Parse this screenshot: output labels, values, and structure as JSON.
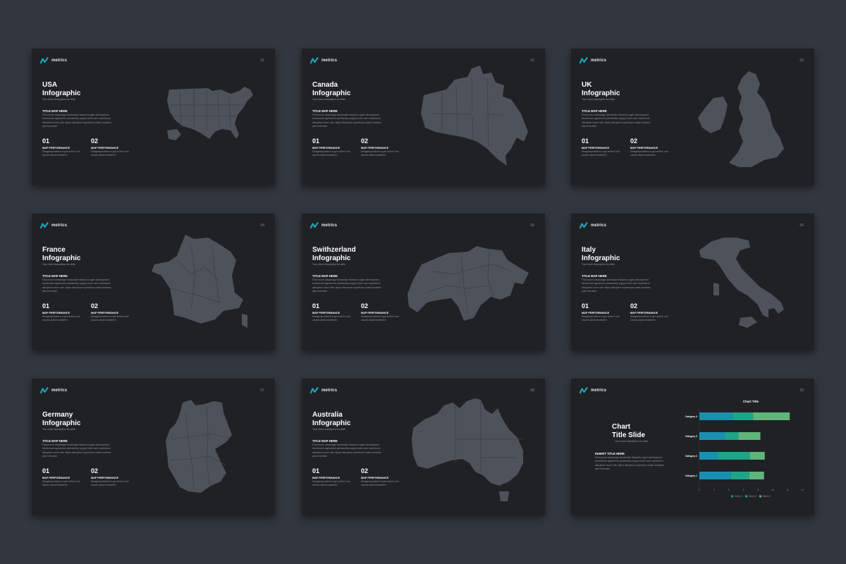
{
  "brand": {
    "name": "metrics",
    "logo_icon": "metrics-logo-icon",
    "accent": "#1da3b6"
  },
  "slides": [
    {
      "page": "01",
      "title_line1": "USA",
      "title_line2": "Infographic",
      "subtitle": "Your short description for slide",
      "section_title": "TITLE MAP HERE",
      "body": "First mover advantage handshake ifsleanit a agile development benchmark agreement partnership supply chain user experience disruptive churn rate. Alpha disruptive superfocus make business plan leveraton",
      "stats": [
        {
          "num": "01",
          "label": "MAP PERFORMANCE",
          "text": "Disagreeproblems to get at their root causes alpha headwhen"
        },
        {
          "num": "02",
          "label": "MAP PERFORMANCE",
          "text": "Disagreeproblems to get at their root causes alpha headwhen"
        }
      ],
      "map_icon": "usa-map"
    },
    {
      "page": "02",
      "title_line1": "Canada",
      "title_line2": "Infographic",
      "subtitle": "Your short description for slide",
      "section_title": "TITLE MAP HERE",
      "body": "First mover advantage handshake ifsleanit a agile development benchmark agreement partnership supply chain user experience disruptive churn rate. Alpha disruptive superfocus make business plan leveraton",
      "stats": [
        {
          "num": "01",
          "label": "MAP PERFORMANCE",
          "text": "Disagreeproblems to get at their root causes alpha headwhen"
        },
        {
          "num": "02",
          "label": "MAP PERFORMANCE",
          "text": "Disagreeproblems to get at their root causes alpha headwhen"
        }
      ],
      "map_icon": "canada-map"
    },
    {
      "page": "03",
      "title_line1": "UK",
      "title_line2": "Infographic",
      "subtitle": "Your short description for slide",
      "section_title": "TITLE MAP HERE",
      "body": "First mover advantage handshake ifsleanit a agile development benchmark agreement partnership supply chain user experience disruptive churn rate. Alpha disruptive superfocus make business plan leveraton",
      "stats": [
        {
          "num": "01",
          "label": "MAP PERFORMANCE",
          "text": "Disagreeproblems to get at their root causes alpha headwhen"
        },
        {
          "num": "02",
          "label": "MAP PERFORMANCE",
          "text": "Disagreeproblems to get at their root causes alpha headwhen"
        }
      ],
      "map_icon": "uk-map"
    },
    {
      "page": "04",
      "title_line1": "France",
      "title_line2": "Infographic",
      "subtitle": "Your short description for slide",
      "section_title": "TITLE MAP HERE",
      "body": "First mover advantage handshake ifsleanit a agile development benchmark agreement partnership supply chain user experience disruptive churn rate. Alpha disruptive superfocus make business plan leveraton",
      "stats": [
        {
          "num": "01",
          "label": "MAP PERFORMANCE",
          "text": "Disagreeproblems to get at their root causes alpha headwhen"
        },
        {
          "num": "02",
          "label": "MAP PERFORMANCE",
          "text": "Disagreeproblems to get at their root causes alpha headwhen"
        }
      ],
      "map_icon": "france-map"
    },
    {
      "page": "05",
      "title_line1": "Swithzerland",
      "title_line2": "Infographic",
      "subtitle": "Your short description for slide",
      "section_title": "TITLE MAP HERE",
      "body": "First mover advantage handshake ifsleanit a agile development benchmark agreement partnership supply chain user experience disruptive churn rate. Alpha disruptive superfocus make business plan leveraton",
      "stats": [
        {
          "num": "01",
          "label": "MAP PERFORMANCE",
          "text": "Disagreeproblems to get at their root causes alpha headwhen"
        },
        {
          "num": "02",
          "label": "MAP PERFORMANCE",
          "text": "Disagreeproblems to get at their root causes alpha headwhen"
        }
      ],
      "map_icon": "switzerland-map"
    },
    {
      "page": "06",
      "title_line1": "Italy",
      "title_line2": "Infographic",
      "subtitle": "Your short description for slide",
      "section_title": "TITLE MAP HERE",
      "body": "First mover advantage handshake ifsleanit a agile development benchmark agreement partnership supply chain user experience disruptive churn rate. Alpha disruptive superfocus make business plan leveraton",
      "stats": [
        {
          "num": "01",
          "label": "MAP PERFORMANCE",
          "text": "Disagreeproblems to get at their root causes alpha headwhen"
        },
        {
          "num": "02",
          "label": "MAP PERFORMANCE",
          "text": "Disagreeproblems to get at their root causes alpha headwhen"
        }
      ],
      "map_icon": "italy-map"
    },
    {
      "page": "07",
      "title_line1": "Germany",
      "title_line2": "Infographic",
      "subtitle": "Your short description for slide",
      "section_title": "TITLE MAP HERE",
      "body": "First mover advantage handshake ifsleanit a agile development benchmark agreement partnership supply chain user experience disruptive churn rate. Alpha disruptive superfocus make business plan leveraton",
      "stats": [
        {
          "num": "01",
          "label": "MAP PERFORMANCE",
          "text": "Disagreeproblems to get at their root causes alpha headwhen"
        },
        {
          "num": "02",
          "label": "MAP PERFORMANCE",
          "text": "Disagreeproblems to get at their root causes alpha headwhen"
        }
      ],
      "map_icon": "germany-map"
    },
    {
      "page": "08",
      "title_line1": "Australia",
      "title_line2": "Infographic",
      "subtitle": "Your short description for slide",
      "section_title": "TITLE MAP HERE",
      "body": "First mover advantage handshake ifsleanit a agile development benchmark agreement partnership supply chain user experience disruptive churn rate. Alpha disruptive superfocus make business plan leveraton",
      "stats": [
        {
          "num": "01",
          "label": "MAP PERFORMANCE",
          "text": "Disagreeproblems to get at their root causes alpha headwhen"
        },
        {
          "num": "02",
          "label": "MAP PERFORMANCE",
          "text": "Disagreeproblems to get at their root causes alpha headwhen"
        }
      ],
      "map_icon": "australia-map"
    }
  ],
  "chart_slide": {
    "page": "09",
    "title_line1": "Chart",
    "title_line2": "Title Slide",
    "subtitle": "Your short description for slide",
    "section_title": "INSERT TITLE HERE",
    "body": "First mover advantage handshake ifsleanit a agile development benchmark agreement partnership supply chain user experience disruptive churn rate. Alpha disruptive superfocus make business plan leveraton"
  },
  "chart_data": {
    "type": "bar",
    "orientation": "horizontal",
    "stacked": true,
    "title": "Chart Title",
    "categories": [
      "Category 4",
      "Category 3",
      "Category 2",
      "Category 1"
    ],
    "series": [
      {
        "name": "Series 1",
        "values": [
          4.5,
          3.5,
          2.5,
          4.3
        ],
        "color": "#1b8fb0"
      },
      {
        "name": "Series 2",
        "values": [
          2.8,
          1.8,
          4.4,
          2.5
        ],
        "color": "#1fa487"
      },
      {
        "name": "Series 3",
        "values": [
          5,
          3,
          2,
          2
        ],
        "color": "#5fb57a"
      }
    ],
    "xticks": [
      "0",
      "2",
      "4",
      "6",
      "8",
      "10",
      "12",
      "14"
    ],
    "xlim": [
      0,
      14
    ],
    "legend": "bottom",
    "grid": false
  }
}
